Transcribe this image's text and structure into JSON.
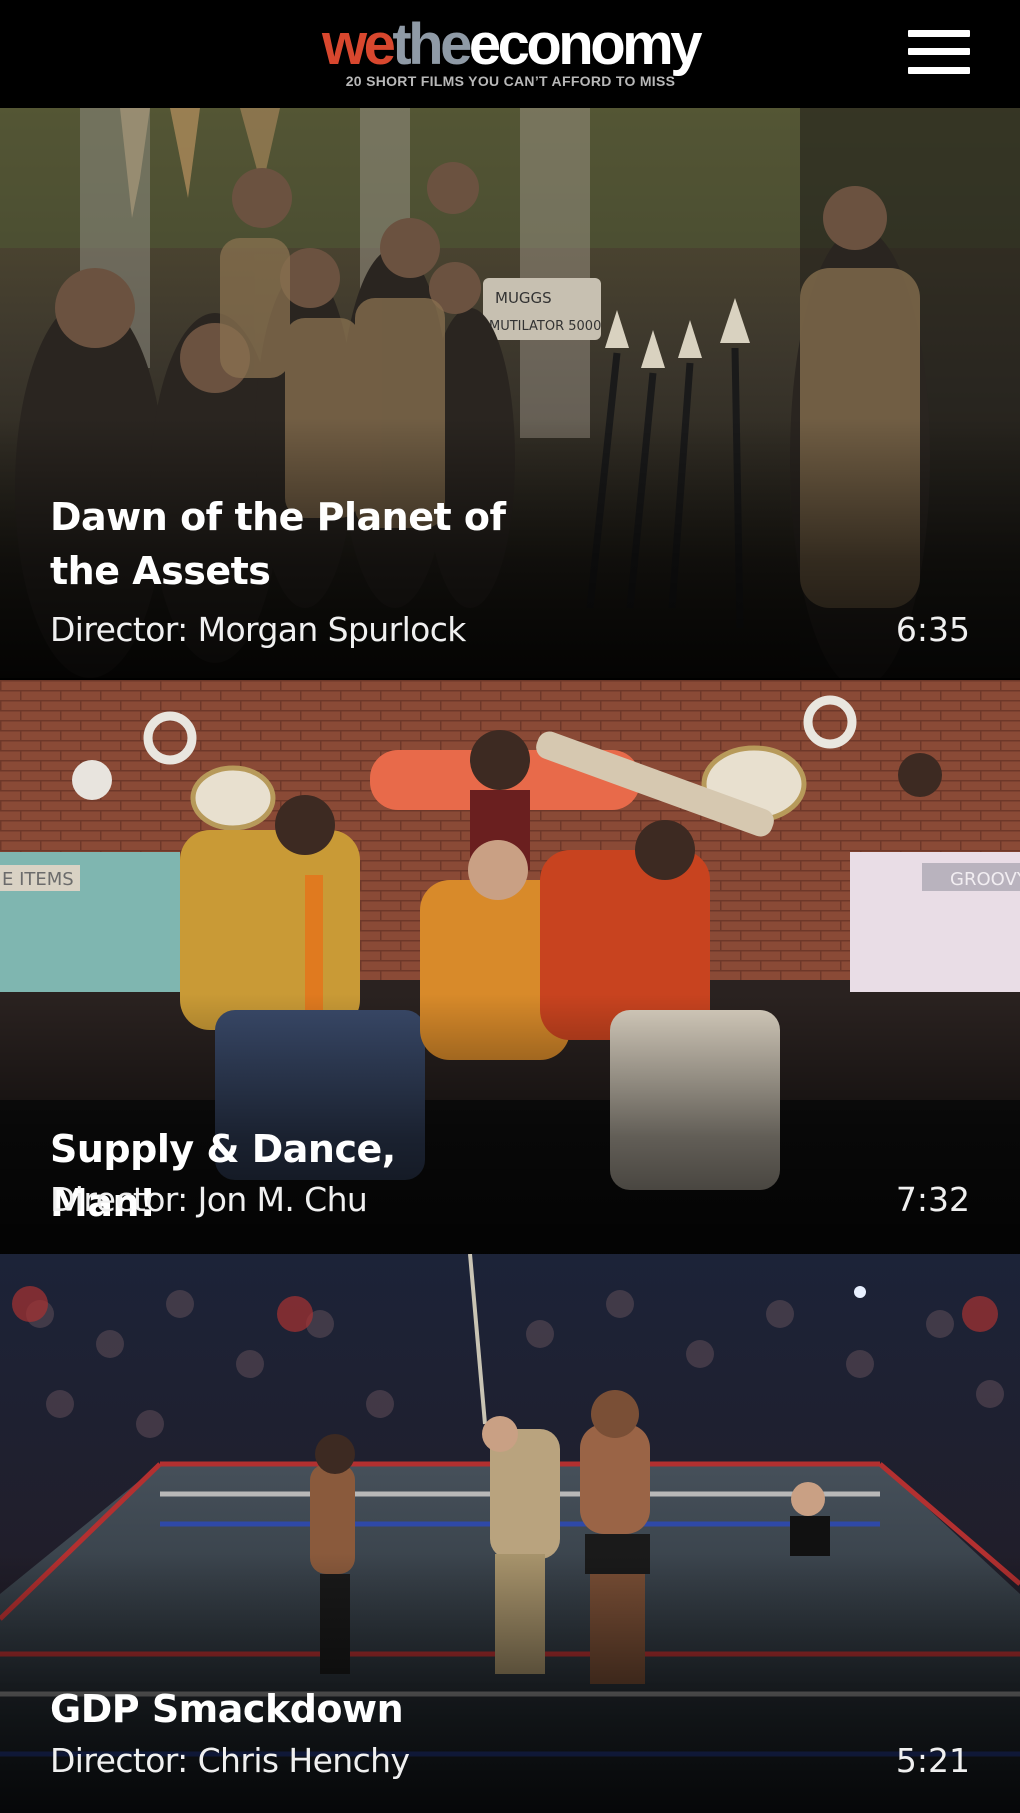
{
  "header": {
    "logo": {
      "we": "we",
      "the": "the",
      "economy": "economy"
    },
    "tagline": "20 SHORT FILMS YOU CAN’T AFFORD TO MISS",
    "menu_icon": "hamburger-menu-icon"
  },
  "films": [
    {
      "title": "Dawn of the Planet of the Assets",
      "director": "Director: Morgan Spurlock",
      "duration": "6:35",
      "sign_text": "MUGGS MUTILATOR 5000"
    },
    {
      "title": "Supply & Dance, Man!",
      "director": "Director: Jon M. Chu",
      "duration": "7:32",
      "left_sign": "E ITEMS",
      "right_sign": "GROOVY"
    },
    {
      "title": "GDP Smackdown",
      "director": "Director: Chris Henchy",
      "duration": "5:21"
    }
  ],
  "colors": {
    "logo_we": "#d8472e",
    "logo_the": "#8f9aa6",
    "logo_economy": "#ffffff",
    "background": "#000000"
  }
}
